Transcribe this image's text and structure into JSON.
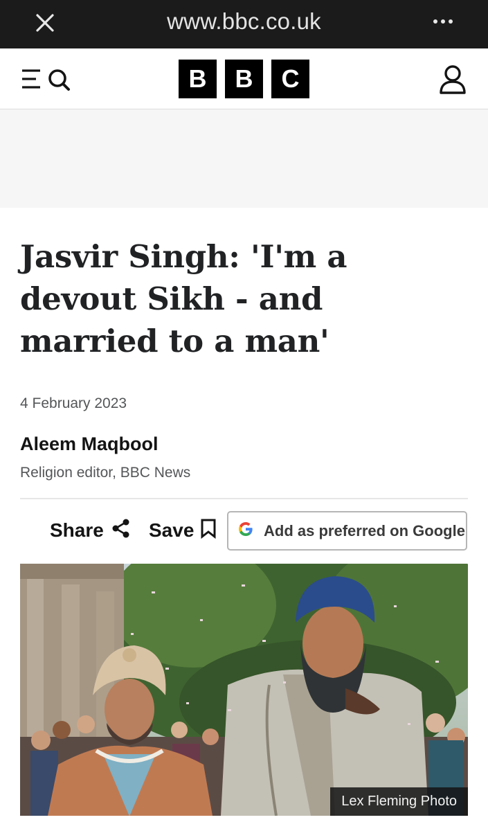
{
  "browser": {
    "url": "www.bbc.co.uk",
    "close_icon": "close-icon",
    "more_icon": "more-horizontal-icon"
  },
  "header": {
    "menu_icon": "menu-search-icon",
    "logo_letters": [
      "B",
      "B",
      "C"
    ],
    "account_icon": "account-icon"
  },
  "article": {
    "headline": "Jasvir Singh: 'I'm a devout Sikh - and married to a man'",
    "date": "4 February 2023",
    "author": {
      "name": "Aleem Maqbool",
      "role": "Religion editor, BBC News"
    },
    "actions": {
      "share_label": "Share",
      "save_label": "Save",
      "google_label": "Add as preferred on Google"
    },
    "image": {
      "credit": "Lex Fleming Photo"
    }
  },
  "colors": {
    "browser_bar": "#1b1b1b",
    "logo_block": "#000000",
    "ad_background": "#f6f6f6",
    "text_secondary": "#545658"
  }
}
